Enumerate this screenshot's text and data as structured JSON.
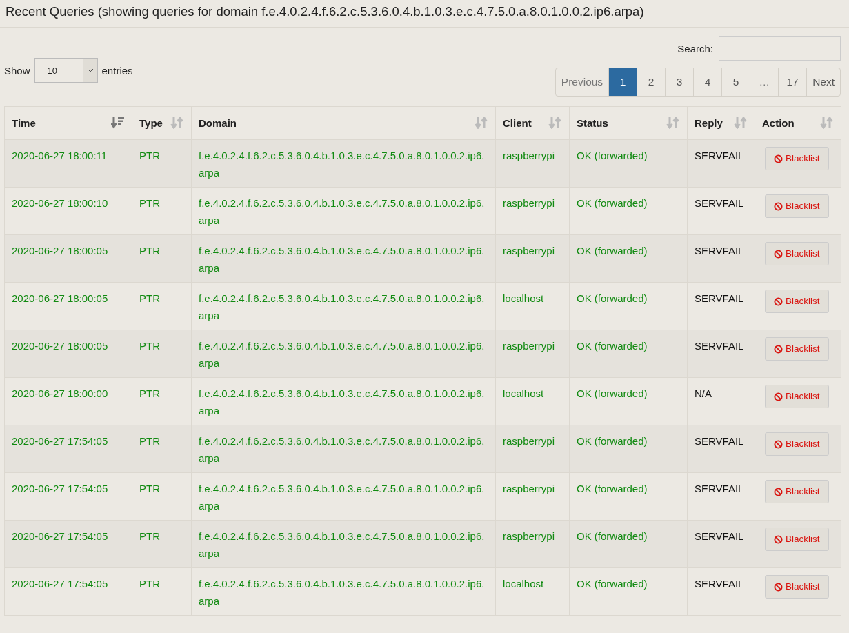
{
  "title": "Recent Queries (showing queries for domain f.e.4.0.2.4.f.6.2.c.5.3.6.0.4.b.1.0.3.e.c.4.7.5.0.a.8.0.1.0.0.2.ip6.arpa)",
  "search": {
    "label": "Search:"
  },
  "length": {
    "prefix": "Show",
    "value": "10",
    "suffix": "entries"
  },
  "pagination": [
    {
      "label": "Previous",
      "selected": false,
      "disabled": true
    },
    {
      "label": "1",
      "selected": true,
      "disabled": false
    },
    {
      "label": "2",
      "selected": false,
      "disabled": false
    },
    {
      "label": "3",
      "selected": false,
      "disabled": false
    },
    {
      "label": "4",
      "selected": false,
      "disabled": false
    },
    {
      "label": "5",
      "selected": false,
      "disabled": false
    },
    {
      "label": "…",
      "selected": false,
      "disabled": true
    },
    {
      "label": "17",
      "selected": false,
      "disabled": false
    },
    {
      "label": "Next",
      "selected": false,
      "disabled": false
    }
  ],
  "table": {
    "columns": [
      {
        "label": "Time",
        "sorted": true
      },
      {
        "label": "Type",
        "sorted": false
      },
      {
        "label": "Domain",
        "sorted": false
      },
      {
        "label": "Client",
        "sorted": false
      },
      {
        "label": "Status",
        "sorted": false
      },
      {
        "label": "Reply",
        "sorted": false
      },
      {
        "label": "Action",
        "sorted": false
      }
    ],
    "rows": [
      {
        "time": "2020-06-27 18:00:11",
        "type": "PTR",
        "domain": "f.e.4.0.2.4.f.6.2.c.5.3.6.0.4.b.1.0.3.e.c.4.7.5.0.a.8.0.1.0.0.2.ip6.arpa",
        "client": "raspberrypi",
        "status": "OK (forwarded)",
        "reply": "SERVFAIL",
        "action": "Blacklist"
      },
      {
        "time": "2020-06-27 18:00:10",
        "type": "PTR",
        "domain": "f.e.4.0.2.4.f.6.2.c.5.3.6.0.4.b.1.0.3.e.c.4.7.5.0.a.8.0.1.0.0.2.ip6.arpa",
        "client": "raspberrypi",
        "status": "OK (forwarded)",
        "reply": "SERVFAIL",
        "action": "Blacklist"
      },
      {
        "time": "2020-06-27 18:00:05",
        "type": "PTR",
        "domain": "f.e.4.0.2.4.f.6.2.c.5.3.6.0.4.b.1.0.3.e.c.4.7.5.0.a.8.0.1.0.0.2.ip6.arpa",
        "client": "raspberrypi",
        "status": "OK (forwarded)",
        "reply": "SERVFAIL",
        "action": "Blacklist"
      },
      {
        "time": "2020-06-27 18:00:05",
        "type": "PTR",
        "domain": "f.e.4.0.2.4.f.6.2.c.5.3.6.0.4.b.1.0.3.e.c.4.7.5.0.a.8.0.1.0.0.2.ip6.arpa",
        "client": "localhost",
        "status": "OK (forwarded)",
        "reply": "SERVFAIL",
        "action": "Blacklist"
      },
      {
        "time": "2020-06-27 18:00:05",
        "type": "PTR",
        "domain": "f.e.4.0.2.4.f.6.2.c.5.3.6.0.4.b.1.0.3.e.c.4.7.5.0.a.8.0.1.0.0.2.ip6.arpa",
        "client": "raspberrypi",
        "status": "OK (forwarded)",
        "reply": "SERVFAIL",
        "action": "Blacklist"
      },
      {
        "time": "2020-06-27 18:00:00",
        "type": "PTR",
        "domain": "f.e.4.0.2.4.f.6.2.c.5.3.6.0.4.b.1.0.3.e.c.4.7.5.0.a.8.0.1.0.0.2.ip6.arpa",
        "client": "localhost",
        "status": "OK (forwarded)",
        "reply": "N/A",
        "action": "Blacklist"
      },
      {
        "time": "2020-06-27 17:54:05",
        "type": "PTR",
        "domain": "f.e.4.0.2.4.f.6.2.c.5.3.6.0.4.b.1.0.3.e.c.4.7.5.0.a.8.0.1.0.0.2.ip6.arpa",
        "client": "raspberrypi",
        "status": "OK (forwarded)",
        "reply": "SERVFAIL",
        "action": "Blacklist"
      },
      {
        "time": "2020-06-27 17:54:05",
        "type": "PTR",
        "domain": "f.e.4.0.2.4.f.6.2.c.5.3.6.0.4.b.1.0.3.e.c.4.7.5.0.a.8.0.1.0.0.2.ip6.arpa",
        "client": "raspberrypi",
        "status": "OK (forwarded)",
        "reply": "SERVFAIL",
        "action": "Blacklist"
      },
      {
        "time": "2020-06-27 17:54:05",
        "type": "PTR",
        "domain": "f.e.4.0.2.4.f.6.2.c.5.3.6.0.4.b.1.0.3.e.c.4.7.5.0.a.8.0.1.0.0.2.ip6.arpa",
        "client": "raspberrypi",
        "status": "OK (forwarded)",
        "reply": "SERVFAIL",
        "action": "Blacklist"
      },
      {
        "time": "2020-06-27 17:54:05",
        "type": "PTR",
        "domain": "f.e.4.0.2.4.f.6.2.c.5.3.6.0.4.b.1.0.3.e.c.4.7.5.0.a.8.0.1.0.0.2.ip6.arpa",
        "client": "localhost",
        "status": "OK (forwarded)",
        "reply": "SERVFAIL",
        "action": "Blacklist"
      }
    ]
  }
}
